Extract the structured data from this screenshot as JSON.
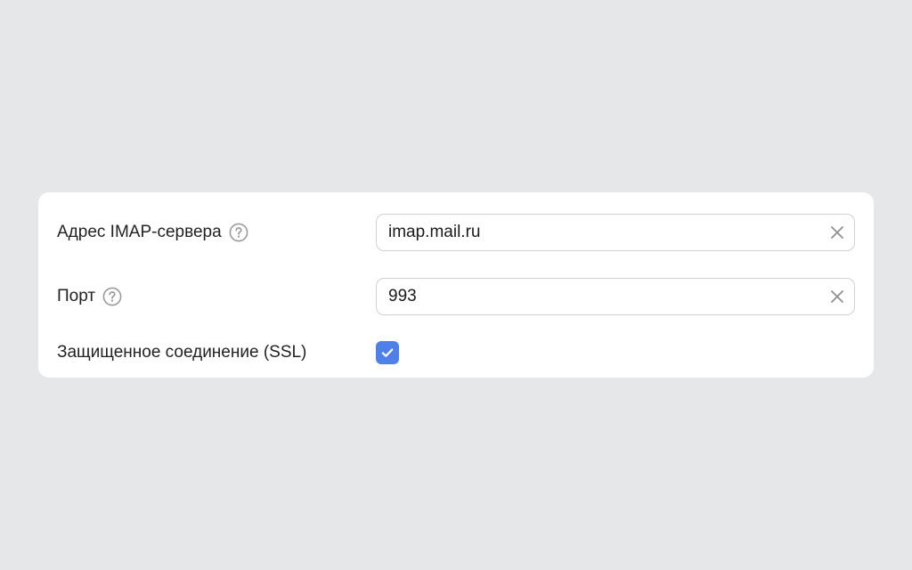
{
  "form": {
    "imap": {
      "label": "Адрес IMAP-сервера",
      "value": "imap.mail.ru",
      "help_icon": "question-circle-icon",
      "clear_icon": "close-icon"
    },
    "port": {
      "label": "Порт",
      "value": "993",
      "help_icon": "question-circle-icon",
      "clear_icon": "close-icon"
    },
    "ssl": {
      "label": "Защищенное соединение (SSL)",
      "checked": true,
      "check_icon": "checkmark-icon"
    }
  },
  "colors": {
    "background": "#e6e7e9",
    "card": "#ffffff",
    "accent": "#4f7fe8",
    "input_border": "#cfd1d4",
    "icon_gray": "#9a9a9a"
  }
}
